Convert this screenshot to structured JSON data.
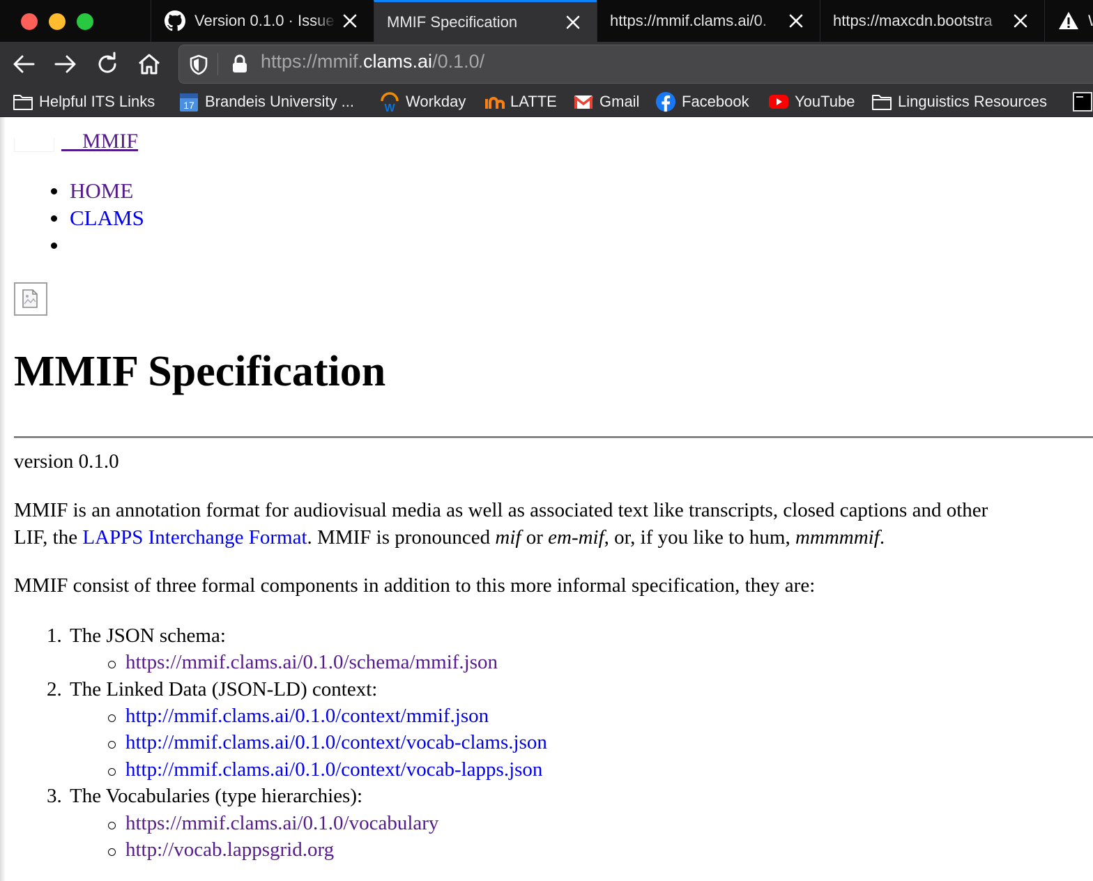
{
  "browser": {
    "tabs": [
      {
        "title": "Version 0.1.0 · Issue",
        "icon": "github-icon",
        "active": false
      },
      {
        "title": "MMIF Specification",
        "icon": "",
        "active": true
      },
      {
        "title": "https://mmif.clams.ai/0.",
        "icon": "",
        "active": false
      },
      {
        "title": "https://maxcdn.bootstra",
        "icon": "",
        "active": false
      },
      {
        "title": "W",
        "icon": "warning-icon",
        "active": false
      }
    ],
    "url": {
      "prefix": "https://mmif.",
      "domain": "clams.ai",
      "suffix": "/0.1.0/"
    },
    "bookmarks": [
      {
        "label": "Helpful ITS Links",
        "icon": "folder-icon"
      },
      {
        "label": "Brandeis University ...",
        "icon": "calendar-icon",
        "icon_text": "17"
      },
      {
        "label": "Workday",
        "icon": "workday-icon"
      },
      {
        "label": "LATTE",
        "icon": "latte-icon"
      },
      {
        "label": "Gmail",
        "icon": "gmail-icon"
      },
      {
        "label": "Facebook",
        "icon": "facebook-icon"
      },
      {
        "label": "YouTube",
        "icon": "youtube-icon"
      },
      {
        "label": "Linguistics Resources",
        "icon": "folder-icon"
      }
    ]
  },
  "page": {
    "brand": "MMIF",
    "nav": [
      "HOME",
      "CLAMS",
      ""
    ],
    "title": "MMIF Specification",
    "version": "version 0.1.0",
    "intro": {
      "line1": "MMIF is an annotation format for audiovisual media as well as associated text like transcripts, closed captions and other",
      "line2_pre": "LIF, the ",
      "line2_link": "LAPPS Interchange Format",
      "line2_mid": ". MMIF is pronounced ",
      "line2_em1": "mif",
      "line2_or": " or ",
      "line2_em2": "em-mif",
      "line2_post": ", or, if you like to hum, ",
      "line2_em3": "mmmmmif",
      "line2_end": "."
    },
    "components_intro": "MMIF consist of three formal components in addition to this more informal specification, they are:",
    "components": [
      {
        "number": "1.",
        "label": "The JSON schema:",
        "links": [
          "https://mmif.clams.ai/0.1.0/schema/mmif.json"
        ]
      },
      {
        "number": "2.",
        "label": "The Linked Data (JSON-LD) context:",
        "links": [
          "http://mmif.clams.ai/0.1.0/context/mmif.json",
          "http://mmif.clams.ai/0.1.0/context/vocab-clams.json",
          "http://mmif.clams.ai/0.1.0/context/vocab-lapps.json"
        ]
      },
      {
        "number": "3.",
        "label": "The Vocabularies (type hierarchies):",
        "links": [
          "https://mmif.clams.ai/0.1.0/vocabulary",
          "http://vocab.lappsgrid.org"
        ]
      }
    ]
  }
}
